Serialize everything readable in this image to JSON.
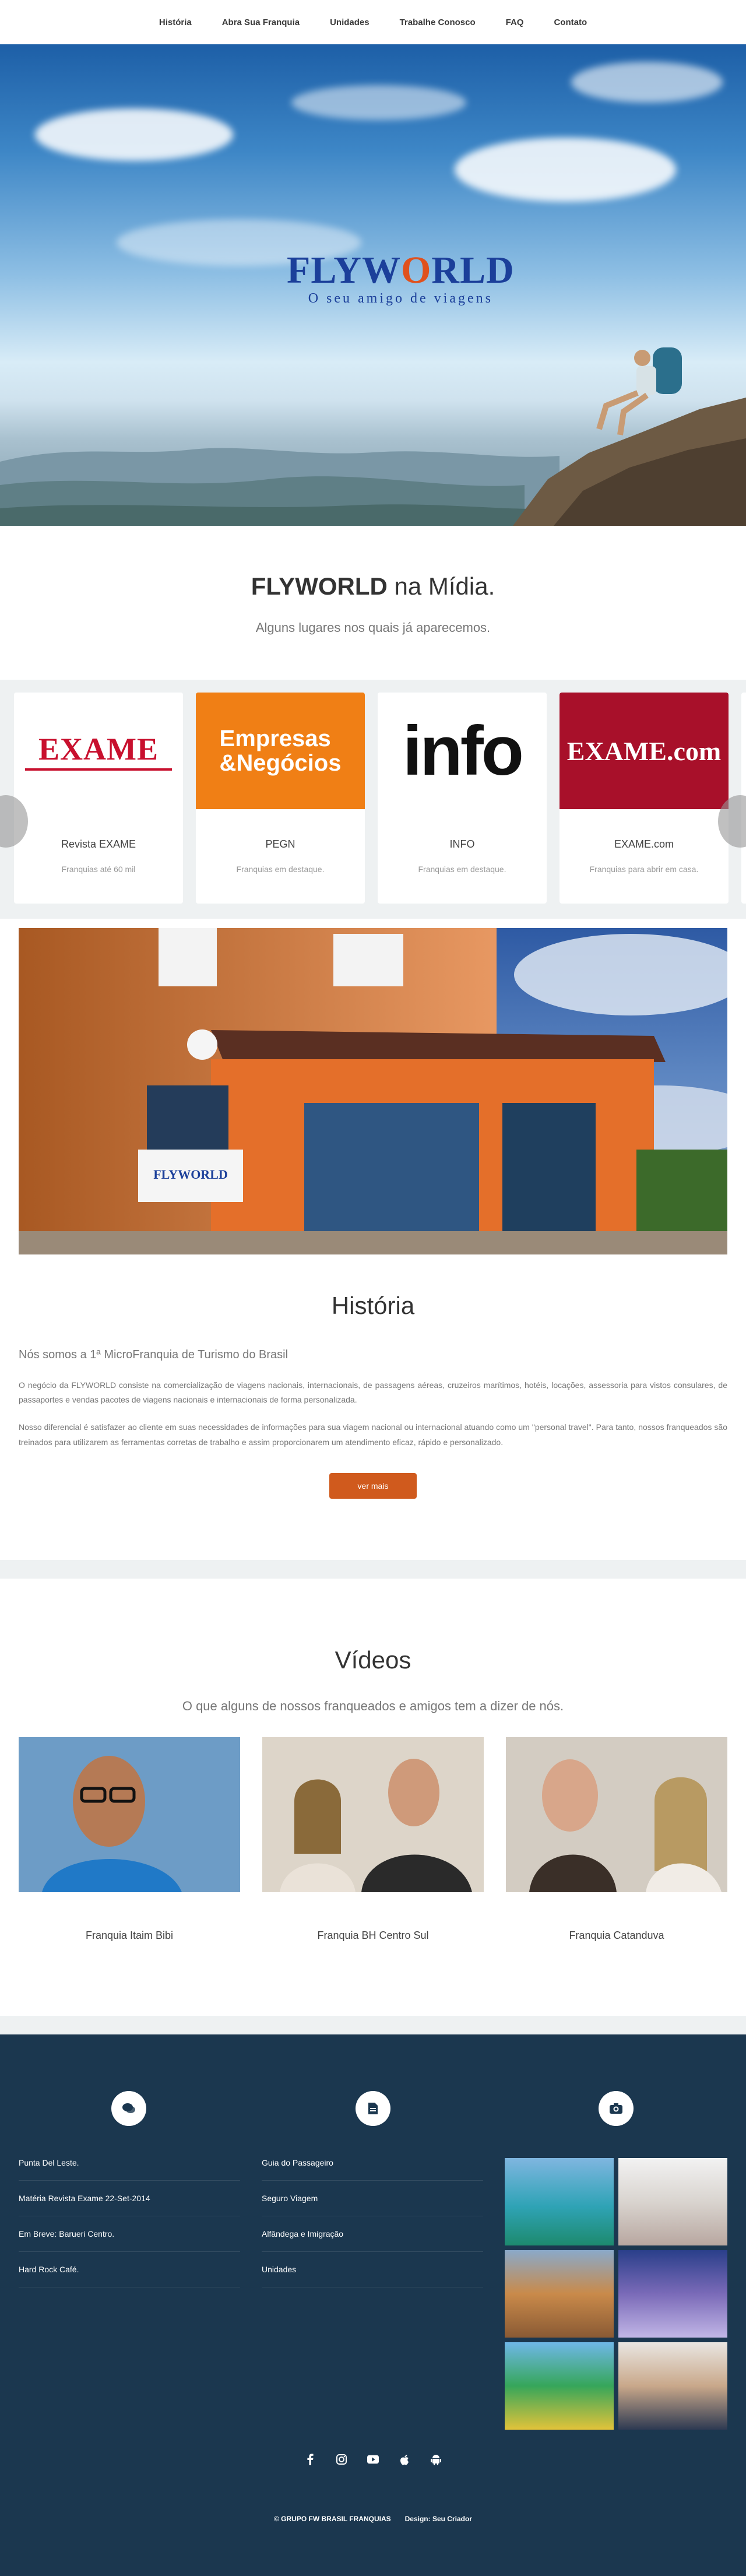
{
  "nav": {
    "items": [
      "História",
      "Abra Sua Franquia",
      "Unidades",
      "Trabalhe Conosco",
      "FAQ",
      "Contato"
    ]
  },
  "hero": {
    "logo_pre": "FLYW",
    "logo_o": "O",
    "logo_post": "RLD",
    "tagline": "O seu amigo de viagens"
  },
  "midia": {
    "title_bold": "FLYWORLD",
    "title_rest": " na Mídia.",
    "subtitle": "Alguns lugares nos quais já aparecemos.",
    "cards": [
      {
        "logo": "EXAME",
        "name": "Revista EXAME",
        "desc": "Franquias até 60 mil"
      },
      {
        "logo_top": "Empresas",
        "logo_bottom": "&Negócios",
        "name": "PEGN",
        "desc": "Franquias em destaque."
      },
      {
        "logo": "info",
        "name": "INFO",
        "desc": "Franquias em destaque."
      },
      {
        "logo": "EXAME.com",
        "name": "EXAME.com",
        "desc": "Franquias para abrir em casa."
      }
    ]
  },
  "historia": {
    "title": "História",
    "subtitle": "Nós somos a 1ª MicroFranquia de Turismo do Brasil",
    "p1": "O negócio da FLYWORLD consiste na comercialização de viagens nacionais, internacionais, de passagens aéreas, cruzeiros marítimos, hotéis, locações, assessoria para vistos consulares, de passaportes e vendas pacotes de viagens nacionais e internacionais de forma personalizada.",
    "p2": "Nosso diferencial é satisfazer ao cliente em suas necessidades de informações para sua viagem nacional ou internacional atuando como um \"personal travel\". Para tanto, nossos franqueados são treinados para utilizarem as ferramentas corretas de trabalho e assim proporcionarem um atendimento eficaz, rápido e personalizado.",
    "button": "ver mais",
    "store_sign": "FLYWORLD"
  },
  "videos": {
    "title": "Vídeos",
    "subtitle": "O que alguns de nossos franqueados e amigos tem a dizer de nós.",
    "items": [
      "Franquia Itaim Bibi",
      "Franquia BH Centro Sul",
      "Franquia Catanduva"
    ]
  },
  "footer": {
    "col1": [
      "Punta Del Leste.",
      "Matéria Revista Exame 22-Set-2014",
      "Em Breve: Barueri Centro.",
      "Hard Rock Café."
    ],
    "col2": [
      "Guia do Passageiro",
      "Seguro Viagem",
      "Alfândega e Imigração",
      "Unidades"
    ],
    "icons": [
      "chat-icon",
      "document-icon",
      "camera-icon"
    ],
    "social": [
      "facebook-icon",
      "instagram-icon",
      "youtube-icon",
      "apple-icon",
      "android-icon"
    ],
    "copyright": "© GRUPO FW BRASIL FRANQUIAS",
    "design": "Design: Seu Criador"
  },
  "colors": {
    "accent": "#d05a1d",
    "footer_bg": "#1b374f",
    "band": "#eef1f2"
  }
}
